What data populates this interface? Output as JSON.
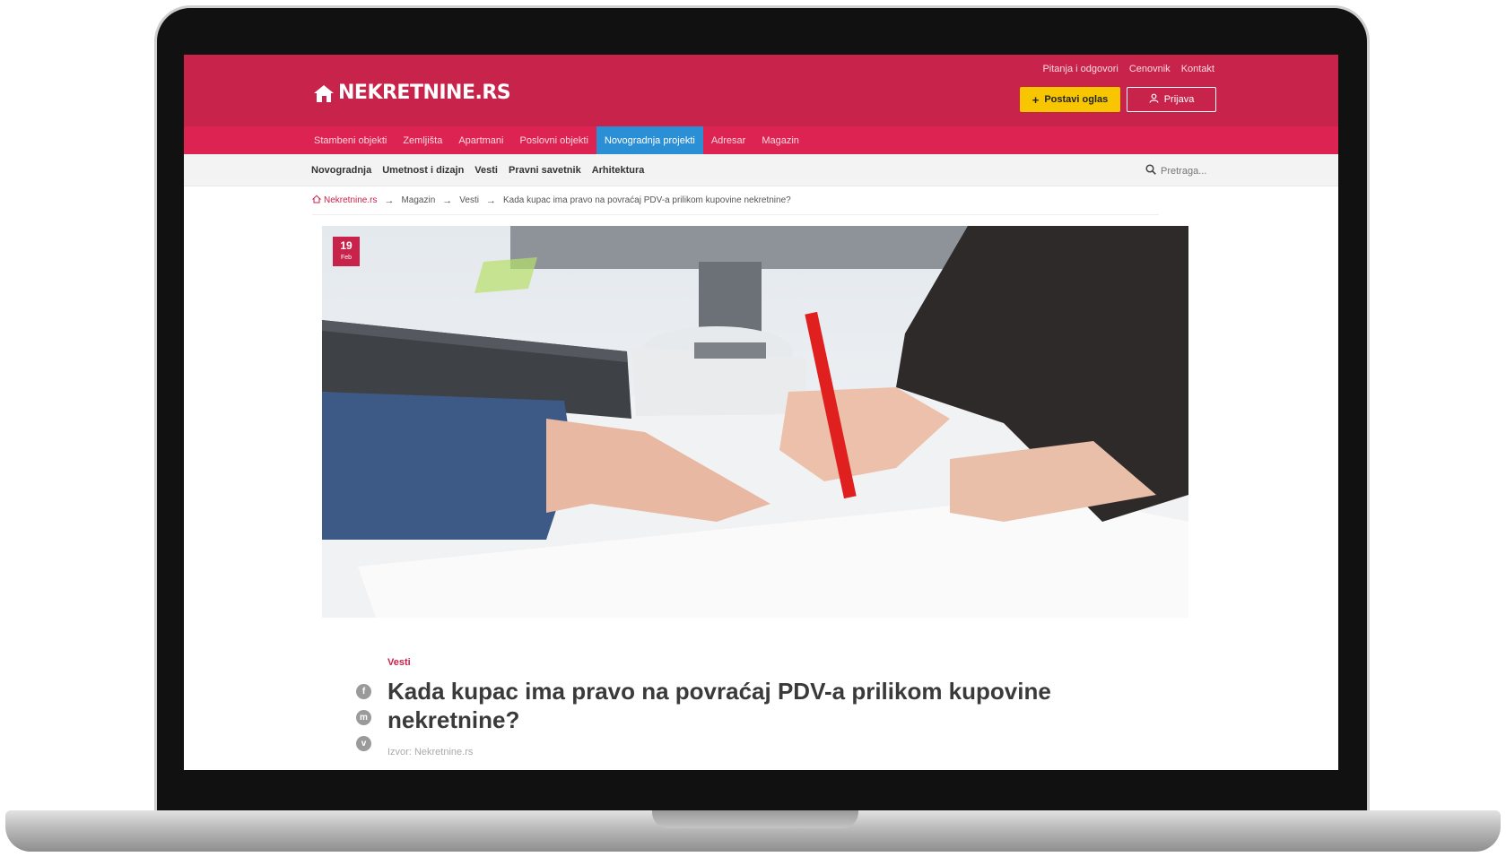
{
  "brand": {
    "name": "NEKRETNINE.RS",
    "color": "#c8234a"
  },
  "top_links": [
    "Pitanja i odgovori",
    "Cenovnik",
    "Kontakt"
  ],
  "buttons": {
    "post_ad": "Postavi oglas",
    "login": "Prijava"
  },
  "main_nav": [
    "Stambeni objekti",
    "Zemljišta",
    "Apartmani",
    "Poslovni objekti",
    "Novogradnja projekti",
    "Adresar",
    "Magazin"
  ],
  "main_nav_active": "Novogradnja projekti",
  "sub_nav": [
    "Novogradnja",
    "Umetnost i dizajn",
    "Vesti",
    "Pravni savetnik",
    "Arhitektura"
  ],
  "search": {
    "placeholder": "Pretraga..."
  },
  "breadcrumb": [
    "Nekretnine.rs",
    "Magazin",
    "Vesti",
    "Kada kupac ima pravo na povraćaj PDV-a prilikom kupovine nekretnine?"
  ],
  "article": {
    "date_day": "19",
    "date_month": "Feb",
    "category": "Vesti",
    "title": "Kada kupac ima pravo na povraćaj PDV-a prilikom kupovine nekretnine?",
    "source": "Izvor: Nekretnine.rs",
    "share_icons": [
      "facebook-icon",
      "messenger-icon",
      "viber-icon"
    ]
  }
}
